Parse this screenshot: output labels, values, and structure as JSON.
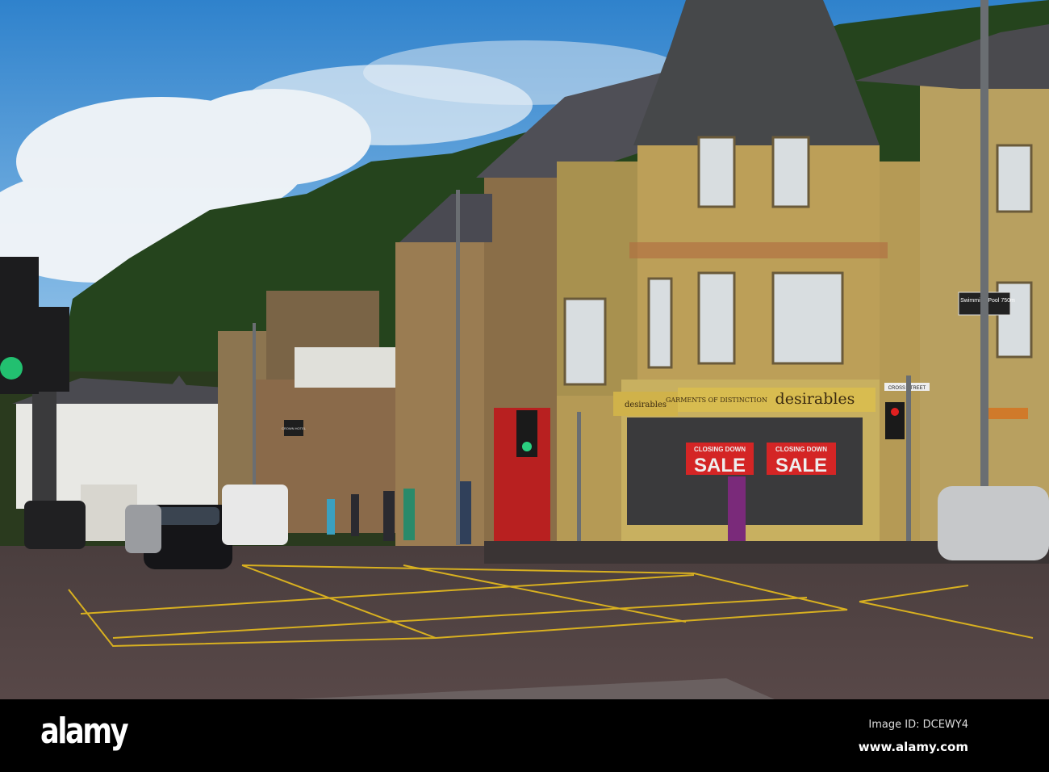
{
  "signs": {
    "shop_name": "desirables",
    "shop_name_side": "desirables",
    "shop_tagline": "GARMENTS OF DISTINCTION",
    "sale_banner_top": "CLOSING DOWN",
    "sale_banner_main": "SALE",
    "street_name": "CROSS STREET",
    "direction_sign": "Swimming Pool 750m",
    "hotel_sign": "CROWN HOTEL"
  },
  "watermark": {
    "logo": "alamy",
    "image_id": "Image ID: DCEWY4",
    "url": "www.alamy.com"
  },
  "colors": {
    "sky": "#3f8fd0",
    "hill": "#24421c",
    "building": "#b59a55",
    "road": "#4f4242",
    "sale_red": "#d42525",
    "line_yellow": "#d8b020"
  }
}
